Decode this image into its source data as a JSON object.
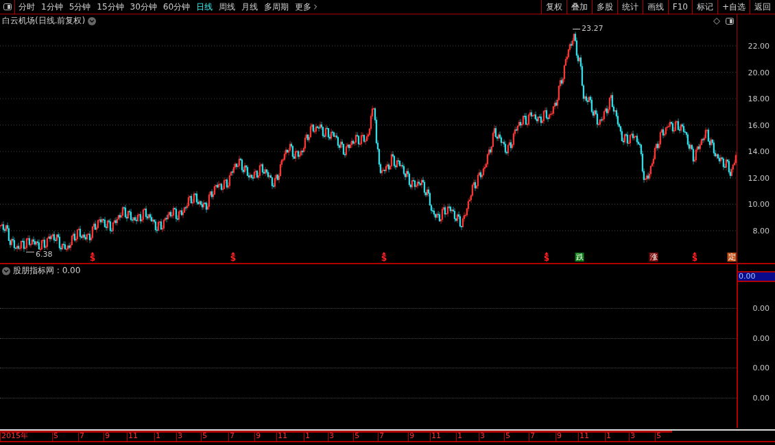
{
  "toolbar": {
    "tabs": [
      {
        "label": "分时",
        "selected": false
      },
      {
        "label": "1分钟",
        "selected": false
      },
      {
        "label": "5分钟",
        "selected": false
      },
      {
        "label": "15分钟",
        "selected": false
      },
      {
        "label": "30分钟",
        "selected": false
      },
      {
        "label": "60分钟",
        "selected": false
      },
      {
        "label": "日线",
        "selected": true
      },
      {
        "label": "周线",
        "selected": false
      },
      {
        "label": "月线",
        "selected": false
      },
      {
        "label": "多周期",
        "selected": false
      },
      {
        "label": "更多",
        "selected": false
      }
    ],
    "buttons": [
      "复权",
      "叠加",
      "多股",
      "统计",
      "画线",
      "F10",
      "标记",
      "+自选",
      "返回"
    ]
  },
  "chart": {
    "title": "白云机场(日线.前复权)",
    "price_axis": [
      "22.00",
      "20.00",
      "18.00",
      "16.00",
      "14.00",
      "12.00",
      "10.00",
      "8.00"
    ],
    "high_label": "23.27",
    "low_label": "6.38",
    "markers": [
      {
        "kind": "signal",
        "text": "$"
      },
      {
        "kind": "signal",
        "text": "$"
      },
      {
        "kind": "signal",
        "text": "$"
      },
      {
        "kind": "signal",
        "text": "$"
      },
      {
        "kind": "tag",
        "text": "跌",
        "color": "#0b7a12"
      },
      {
        "kind": "tag",
        "text": "涨",
        "color": "#7a0a0a"
      },
      {
        "kind": "signal",
        "text": "$"
      },
      {
        "kind": "tag",
        "text": "定",
        "color": "#c8541a"
      }
    ]
  },
  "indicator": {
    "label": "股朋指标网 : 0.00",
    "axis_current": "0.00",
    "axis_labels": [
      "0.00",
      "0.00",
      "0.00",
      "0.00"
    ]
  },
  "time_axis": {
    "labels": [
      "2015年",
      "5",
      "7",
      "9",
      "11",
      "1",
      "3",
      "5",
      "7",
      "9",
      "11",
      "1",
      "3",
      "5",
      "7",
      "9",
      "11",
      "1",
      "3",
      "5",
      "7",
      "9",
      "11",
      "1",
      "3",
      "5"
    ]
  }
}
